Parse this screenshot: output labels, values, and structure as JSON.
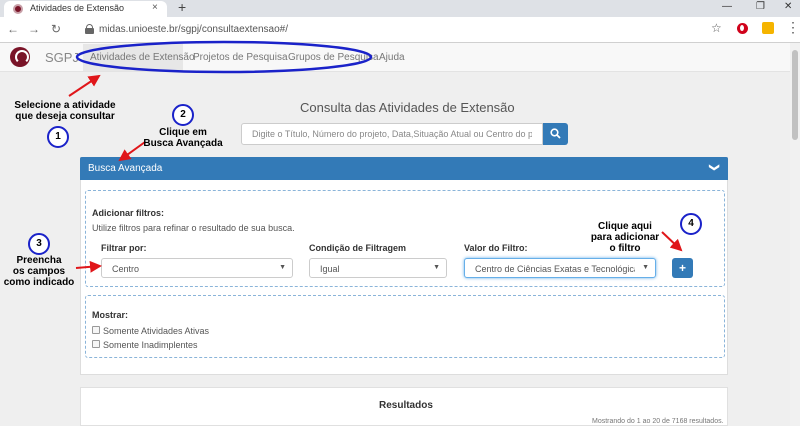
{
  "browser": {
    "tab_title": "Atividades de Extensão",
    "tab_close": "×",
    "new_tab": "+",
    "url": "midas.unioeste.br/sgpj/consultaextensao#/",
    "window_min": "—",
    "window_restore": "❐",
    "window_close": "✕",
    "back": "←",
    "forward": "→",
    "reload": "↻",
    "star": "☆",
    "menu": "⋮"
  },
  "site": {
    "brand": "SGPJ",
    "nav": [
      {
        "label": "Atividades de Extensão",
        "active": true
      },
      {
        "label": "Projetos de Pesquisa",
        "active": false
      },
      {
        "label": "Grupos de Pesquisa",
        "active": false
      },
      {
        "label": "Ajuda",
        "active": false
      }
    ]
  },
  "main": {
    "title": "Consulta das Atividades de Extensão",
    "search_placeholder": "Digite o Título, Número do projeto, Data,Situação Atual ou Centro do projeto"
  },
  "advanced": {
    "header": "Busca Avançada",
    "chevron": "❯",
    "filters_title": "Adicionar filtros:",
    "filters_help": "Utilize filtros para refinar o resultado de sua busca.",
    "filter_by_label": "Filtrar por:",
    "filter_by_value": "Centro",
    "condition_label": "Condição de Filtragem",
    "condition_value": "Igual",
    "value_label": "Valor do Filtro:",
    "value_value": "Centro de Ciências Exatas e Tecnológicas - C",
    "add_button": "+",
    "show_title": "Mostrar:",
    "show_options": [
      "Somente Atividades Ativas",
      "Somente Inadimplentes"
    ]
  },
  "results": {
    "title": "Resultados",
    "count_text": "Mostrando do 1 ao 20 de 7168 resultados."
  },
  "annotations": {
    "step1_text": [
      "Selecione a atividade",
      "que deseja consultar"
    ],
    "step1_num": "1",
    "step2_text": [
      "Clique em",
      "Busca Avançada"
    ],
    "step2_num": "2",
    "step3_text": [
      "Preencha",
      "os campos",
      "como indicado"
    ],
    "step3_num": "3",
    "step4_text": [
      "Clique aqui",
      "para adicionar",
      "o filtro"
    ],
    "step4_num": "4",
    "colors": {
      "circle": "#1a22c9",
      "arrow": "#e0161a"
    }
  },
  "colors": {
    "primary": "#337ab7",
    "brand": "#7a1428"
  }
}
